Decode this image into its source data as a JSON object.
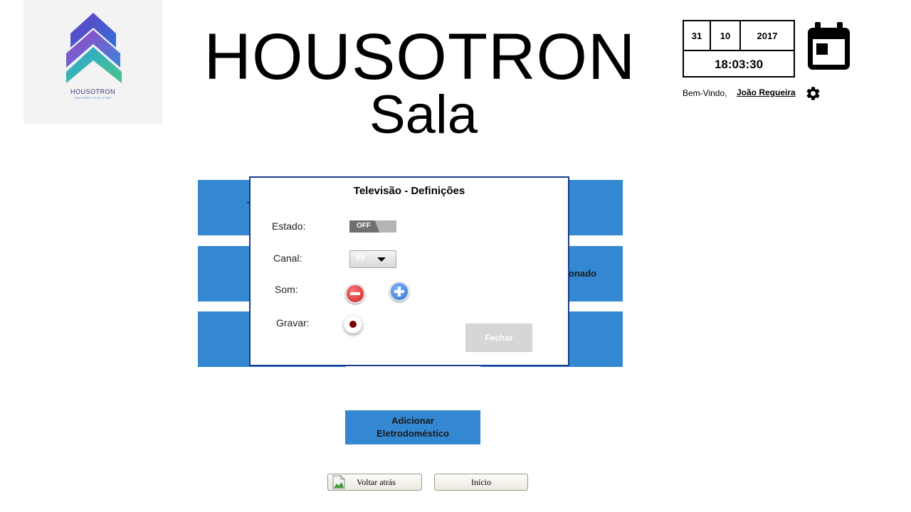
{
  "logo": {
    "name": "HOUSOTRON",
    "tagline": "EMPOWER YOUR HOME"
  },
  "header": {
    "app_title": "HOUSOTRON",
    "room": "Sala"
  },
  "datetime": {
    "day": "31",
    "month": "10",
    "year": "2017",
    "time": "18:03:30"
  },
  "user": {
    "welcome": "Bem-Vindo,",
    "name": "João Regueira"
  },
  "icons": {
    "calendar": "calendar-icon",
    "settings": "gear-icon"
  },
  "tiles": {
    "partial_label_1": "T",
    "partial_label_2": "onado"
  },
  "dialog": {
    "title": "Televisão - Definições",
    "labels": {
      "estado": "Estado:",
      "canal": "Canal:",
      "som": "Som:",
      "gravar": "Gravar:"
    },
    "toggle": "OFF",
    "channel": "89",
    "close": "Fechar"
  },
  "add_button": {
    "line1": "Adicionar",
    "line2": "Eletrodoméstico"
  },
  "nav": {
    "back": "Voltar atrás",
    "home": "Início"
  },
  "colors": {
    "tile_blue": "#3388d1",
    "dialog_border": "#1c3a8a"
  }
}
